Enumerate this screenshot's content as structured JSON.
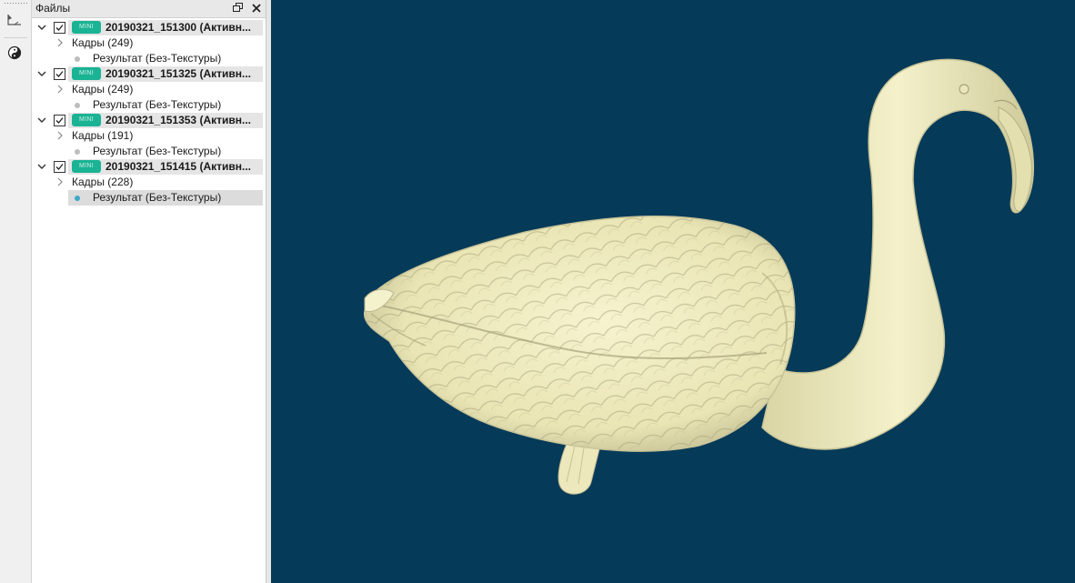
{
  "files_panel": {
    "title": "Файлы",
    "float_icon": "restore-window-icon",
    "close_icon": "close-icon",
    "projects": [
      {
        "name": "20190321_151300 (Активн...",
        "badge": "MINI",
        "checked": true,
        "frames_label": "Кадры (249)",
        "result_label": "Результат (Без-Текстуры)",
        "result_selected": false
      },
      {
        "name": "20190321_151325 (Активн...",
        "badge": "MINI",
        "checked": true,
        "frames_label": "Кадры (249)",
        "result_label": "Результат (Без-Текстуры)",
        "result_selected": false
      },
      {
        "name": "20190321_151353 (Активн...",
        "badge": "MINI",
        "checked": true,
        "frames_label": "Кадры (191)",
        "result_label": "Результат (Без-Текстуры)",
        "result_selected": false
      },
      {
        "name": "20190321_151415 (Активн...",
        "badge": "MINI",
        "checked": true,
        "frames_label": "Кадры (228)",
        "result_label": "Результат (Без-Текстуры)",
        "result_selected": true
      }
    ]
  },
  "toolbar": {
    "tools": [
      "axis-tool-icon",
      "lighting-mode-icon"
    ]
  },
  "viewport": {
    "background_color": "#053a58",
    "model_color": "#f3f0c4",
    "model": "flamingo-3d-scan"
  }
}
